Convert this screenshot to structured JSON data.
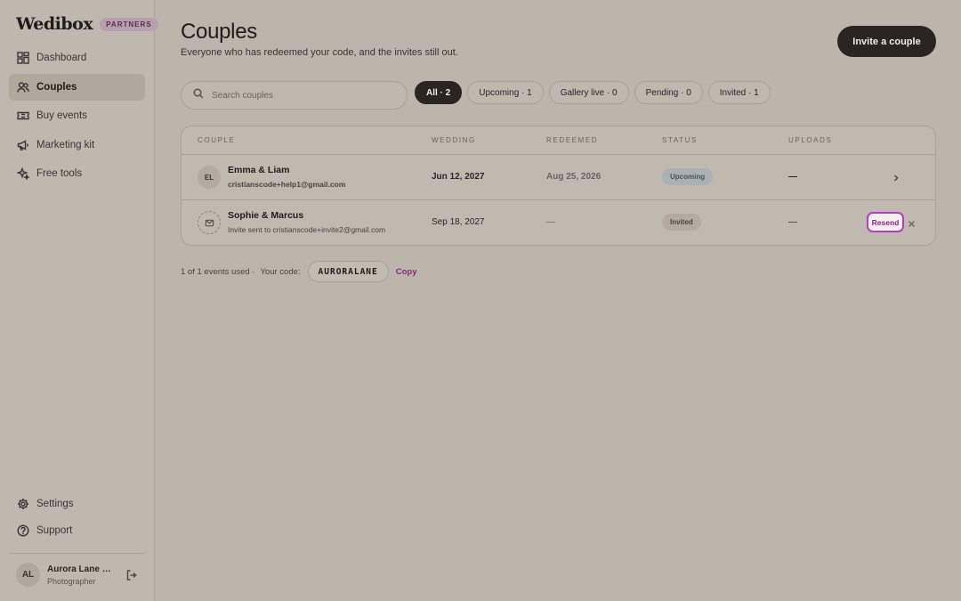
{
  "sidebar": {
    "logo": "Wedibox",
    "badge": "PARTNERS",
    "items": [
      {
        "label": "Dashboard",
        "icon": "grid-icon"
      },
      {
        "label": "Couples",
        "icon": "users-icon"
      },
      {
        "label": "Buy events",
        "icon": "ticket-icon"
      },
      {
        "label": "Marketing kit",
        "icon": "megaphone-icon"
      },
      {
        "label": "Free tools",
        "icon": "sparkle-icon"
      }
    ],
    "bottom_items": [
      {
        "label": "Settings",
        "icon": "gear-icon"
      },
      {
        "label": "Support",
        "icon": "help-icon"
      }
    ],
    "user": {
      "initials": "AL",
      "name": "Aurora Lane Photography",
      "role": "Photographer"
    }
  },
  "header": {
    "title": "Couples",
    "subtitle": "Everyone who has redeemed your code, and the invites still out.",
    "invite_button": "Invite a couple"
  },
  "search": {
    "placeholder": "Search couples"
  },
  "filters": [
    {
      "label": "All · 2",
      "active": true
    },
    {
      "label": "Upcoming · 1",
      "active": false
    },
    {
      "label": "Gallery live · 0",
      "active": false
    },
    {
      "label": "Pending · 0",
      "active": false
    },
    {
      "label": "Invited · 1",
      "active": false
    }
  ],
  "table": {
    "columns": [
      "COUPLE",
      "WEDDING",
      "REDEEMED",
      "STATUS",
      "UPLOADS"
    ],
    "rows": [
      {
        "initials": "EL",
        "name": "Emma & Liam",
        "sub": "cristianscode+help1@gmail.com",
        "wedding": "Jun 12, 2027",
        "redeemed": "Aug 25, 2026",
        "status": "Upcoming",
        "uploads": "—"
      },
      {
        "initials": "",
        "name": "Sophie & Marcus",
        "sub": "Invite sent to cristianscode+invite2@gmail.com",
        "wedding": "Sep 18, 2027",
        "redeemed": "—",
        "status": "Invited",
        "uploads": "—",
        "action": "Resend"
      }
    ]
  },
  "footer": {
    "usage": "1 of 1 events used ·",
    "code_label": "Your code:",
    "code": "AURORALANE",
    "copy": "Copy"
  }
}
